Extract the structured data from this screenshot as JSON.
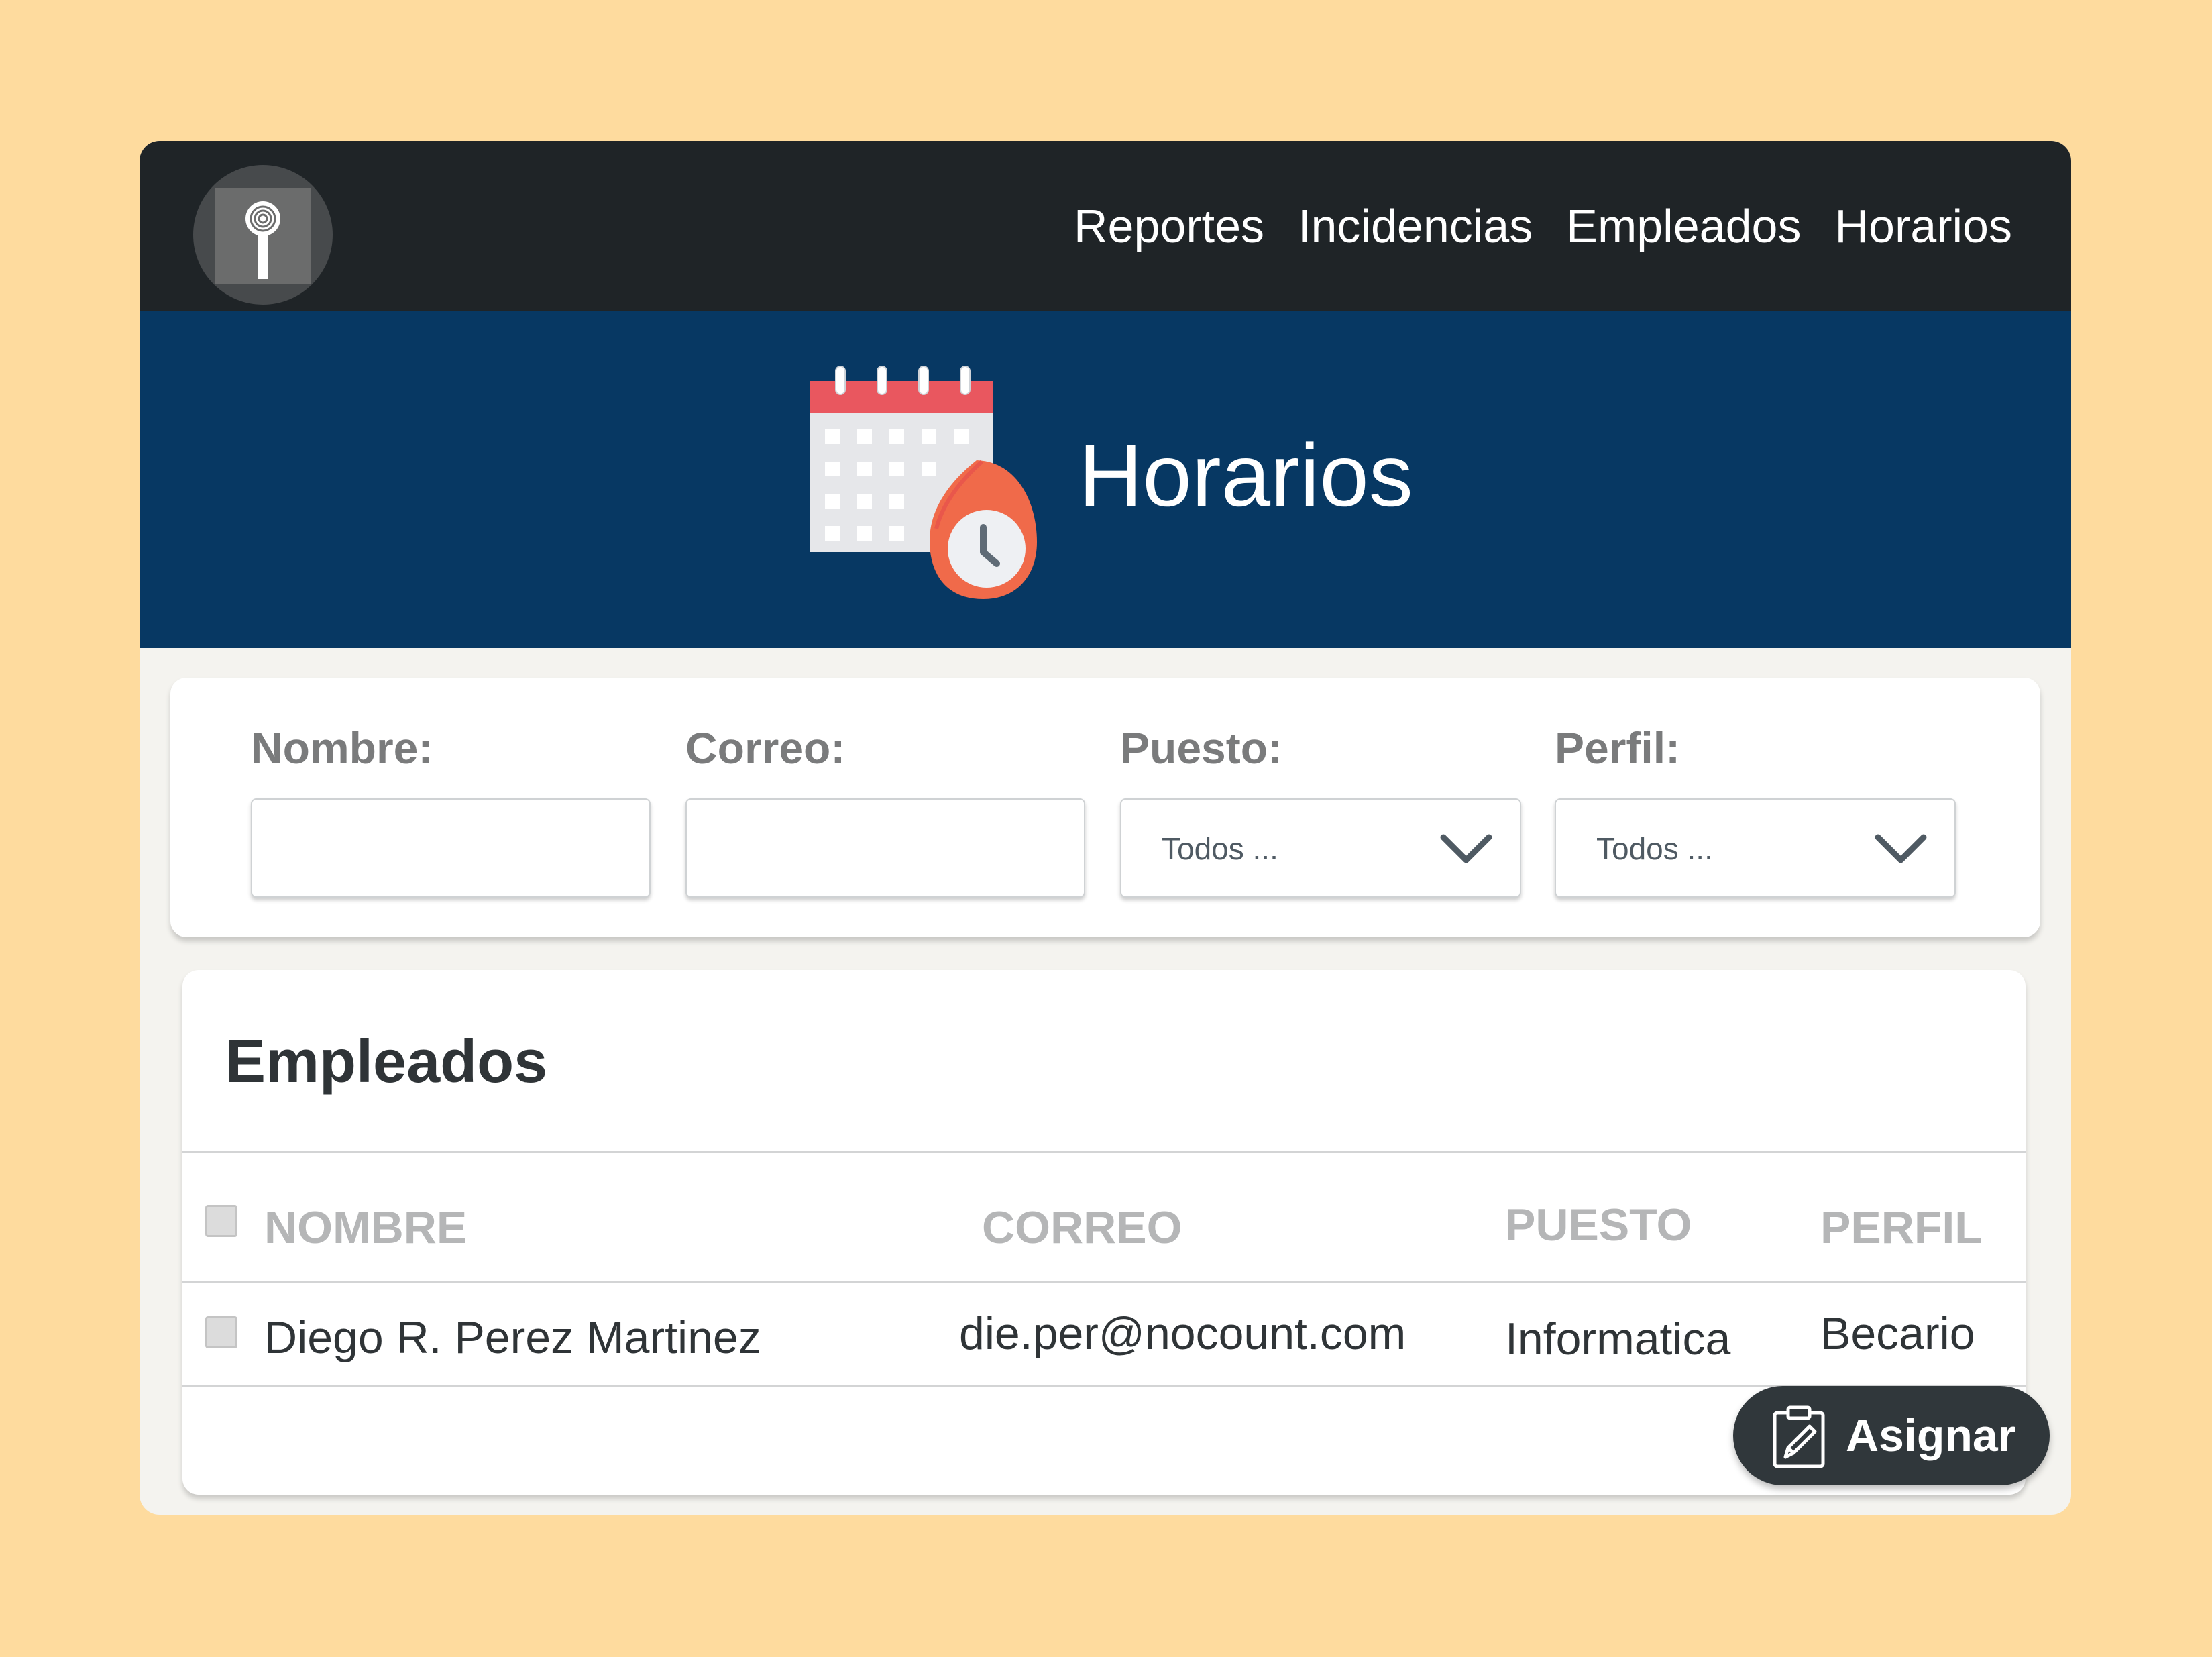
{
  "nav": {
    "items": [
      {
        "label": "Reportes"
      },
      {
        "label": "Incidencias"
      },
      {
        "label": "Empleados"
      },
      {
        "label": "Horarios"
      }
    ]
  },
  "hero": {
    "title": "Horarios",
    "icon": "calendar-clock-icon"
  },
  "filters": {
    "nombre": {
      "label": "Nombre:",
      "value": ""
    },
    "correo": {
      "label": "Correo:",
      "value": ""
    },
    "puesto": {
      "label": "Puesto:",
      "selected": "Todos ..."
    },
    "perfil": {
      "label": "Perfil:",
      "selected": "Todos ..."
    }
  },
  "table": {
    "title": "Empleados",
    "headers": {
      "nombre": "NOMBRE",
      "correo": "CORREO",
      "puesto": "PUESTO",
      "perfil": "PERFIL"
    },
    "rows": [
      {
        "nombre": "Diego R. Perez Martinez",
        "correo": "die.per@nocount.com",
        "puesto": "Informatica",
        "perfil": "Becario",
        "checked": false
      }
    ]
  },
  "assign_button": {
    "label": "Asignar",
    "icon": "clipboard-edit-icon"
  },
  "colors": {
    "page_bg": "#fedb9e",
    "topbar": "#1f2427",
    "hero": "#073863",
    "button": "#30373b"
  }
}
